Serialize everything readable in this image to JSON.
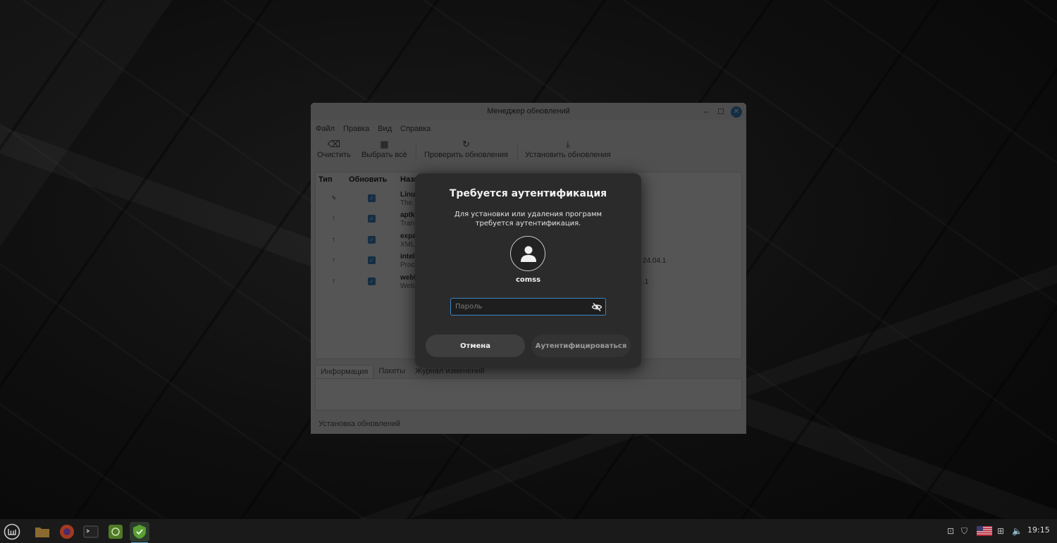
{
  "window": {
    "title": "Менеджер обновлений",
    "controls": {
      "minimize": "–",
      "maximize": "☐",
      "close": "✕"
    },
    "menu": [
      "Файл",
      "Правка",
      "Вид",
      "Справка"
    ],
    "toolbar": {
      "clear": "Очистить",
      "select_all": "Выбрать всё",
      "check": "Проверить обновления",
      "install": "Установить обновления"
    },
    "columns": {
      "type": "Тип",
      "update": "Обновить",
      "name": "Назв"
    },
    "rows": [
      {
        "type_icon": "lightning-icon",
        "name": "Linux",
        "desc": "The",
        "version": ""
      },
      {
        "type_icon": "arrow-up-icon",
        "name": "aptk",
        "desc": "Tran",
        "version": ""
      },
      {
        "type_icon": "arrow-up-icon",
        "name": "expa",
        "desc": "XML",
        "version": ""
      },
      {
        "type_icon": "arrow-up-icon",
        "name": "intel",
        "desc": "Proc",
        "version": "24.04.1"
      },
      {
        "type_icon": "arrow-up-icon",
        "name": "webk",
        "desc": "Web",
        "version": ".1"
      }
    ],
    "tabs": [
      "Информация",
      "Пакеты",
      "Журнал изменений"
    ],
    "status": "Установка обновлений"
  },
  "dialog": {
    "title": "Требуется аутентификация",
    "message": "Для установки или удаления программ требуется аутентификация.",
    "username": "comss",
    "password_placeholder": "Пароль",
    "cancel_label": "Отмена",
    "auth_label": "Аутентифицироваться"
  },
  "taskbar": {
    "apps": [
      "mint-menu-icon",
      "files-icon",
      "firefox-icon",
      "terminal-icon",
      "mintinstall-icon",
      "update-manager-icon"
    ],
    "tray": [
      "updates-tray-icon",
      "shield-tray-icon",
      "us-flag-icon",
      "network-icon",
      "volume-icon"
    ],
    "clock": "19:15"
  },
  "colors": {
    "accent": "#3d86c6",
    "dialog_bg": "#2b2b2b",
    "panel_bg": "#1a1a1a"
  }
}
